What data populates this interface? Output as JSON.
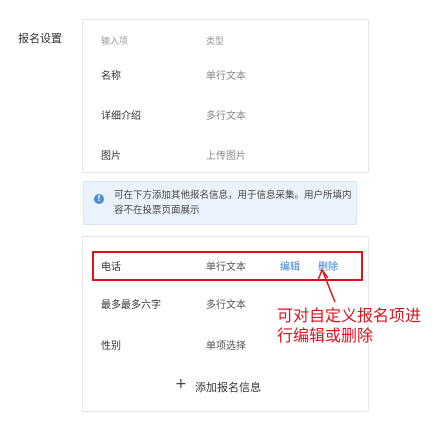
{
  "section_label": "报名设置",
  "fixed_fields": {
    "header": {
      "name": "输入项",
      "type": "类型"
    },
    "rows": [
      {
        "name": "名称",
        "type": "单行文本"
      },
      {
        "name": "详细介绍",
        "type": "多行文本"
      },
      {
        "name": "图片",
        "type": "上传图片"
      }
    ]
  },
  "notice": {
    "text": "可在下方添加其他报名信息，用于信息采集。用户所填内容不在投票页面展示"
  },
  "custom_fields": {
    "rows": [
      {
        "name": "电话",
        "type": "单行文本",
        "edit": "编辑",
        "delete": "删除"
      },
      {
        "name": "最多最多六字",
        "type": "多行文本"
      },
      {
        "name": "性别",
        "type": "单项选择"
      }
    ],
    "add_label": "添加报名信息"
  },
  "annotation": "可对自定义报名项进行编辑或删除",
  "colors": {
    "accent": "#3a7fd0",
    "highlight": "#d9141d",
    "notice_bg": "#eaf3fb"
  }
}
